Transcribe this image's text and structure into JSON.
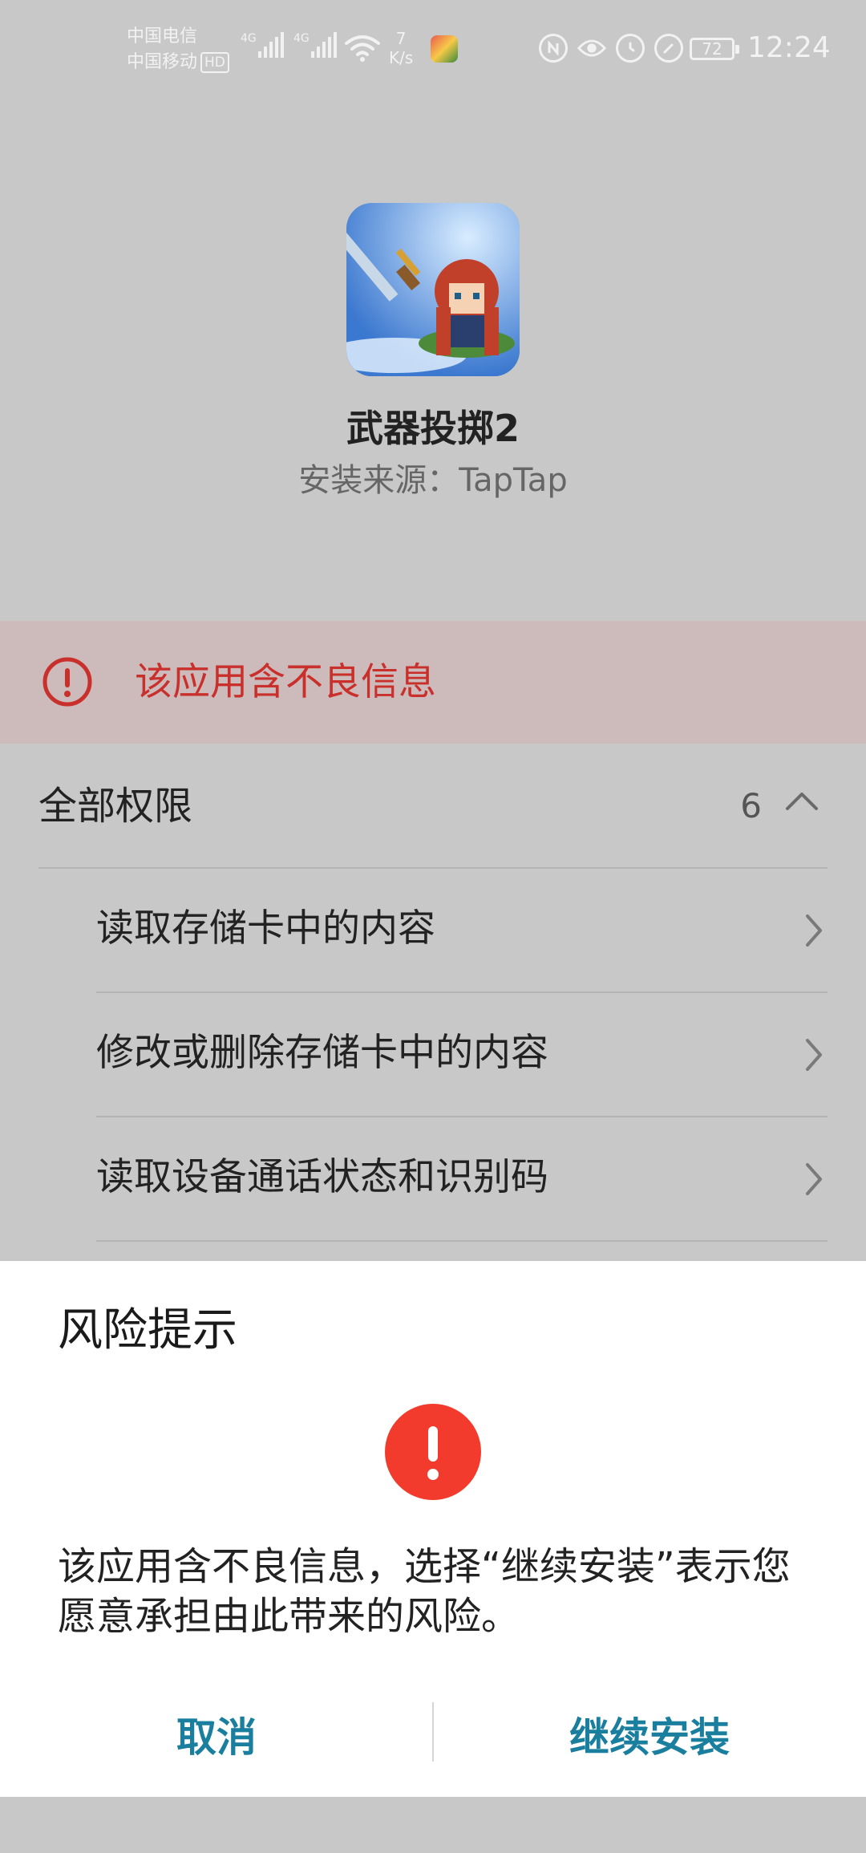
{
  "status_bar": {
    "carrier_1": "中国电信",
    "carrier_2": "中国移动",
    "hd_badge": "HD",
    "signal_1_tag": "4G",
    "signal_2_tag": "4G",
    "net_speed_value": "7",
    "net_speed_unit": "K/s",
    "battery_level": "72",
    "time": "12:24",
    "icons": [
      "carrier-hd-icon",
      "signal-icon",
      "signal-icon",
      "wifi-icon",
      "game-notification-icon",
      "nfc-icon",
      "eye-comfort-icon",
      "alarm-icon",
      "speed-icon",
      "battery-icon"
    ]
  },
  "app": {
    "name": "武器投掷2",
    "source": "安装来源：TapTap"
  },
  "warning_banner": {
    "text": "该应用含不良信息",
    "icon": "exclamation-circle-icon",
    "color": "#c9302c"
  },
  "permissions": {
    "header": "全部权限",
    "count": "6",
    "items": [
      {
        "label": "读取存储卡中的内容"
      },
      {
        "label": "修改或删除存储卡中的内容"
      },
      {
        "label": "读取设备通话状态和识别码"
      }
    ]
  },
  "dialog": {
    "title": "风险提示",
    "message": "该应用含不良信息，选择“继续安装”表示您愿意承担由此带来的风险。",
    "cancel_label": "取消",
    "continue_label": "继续安装",
    "icon": "exclamation-circle-icon",
    "icon_color": "#f23b2c",
    "button_color": "#1a7f9e"
  }
}
